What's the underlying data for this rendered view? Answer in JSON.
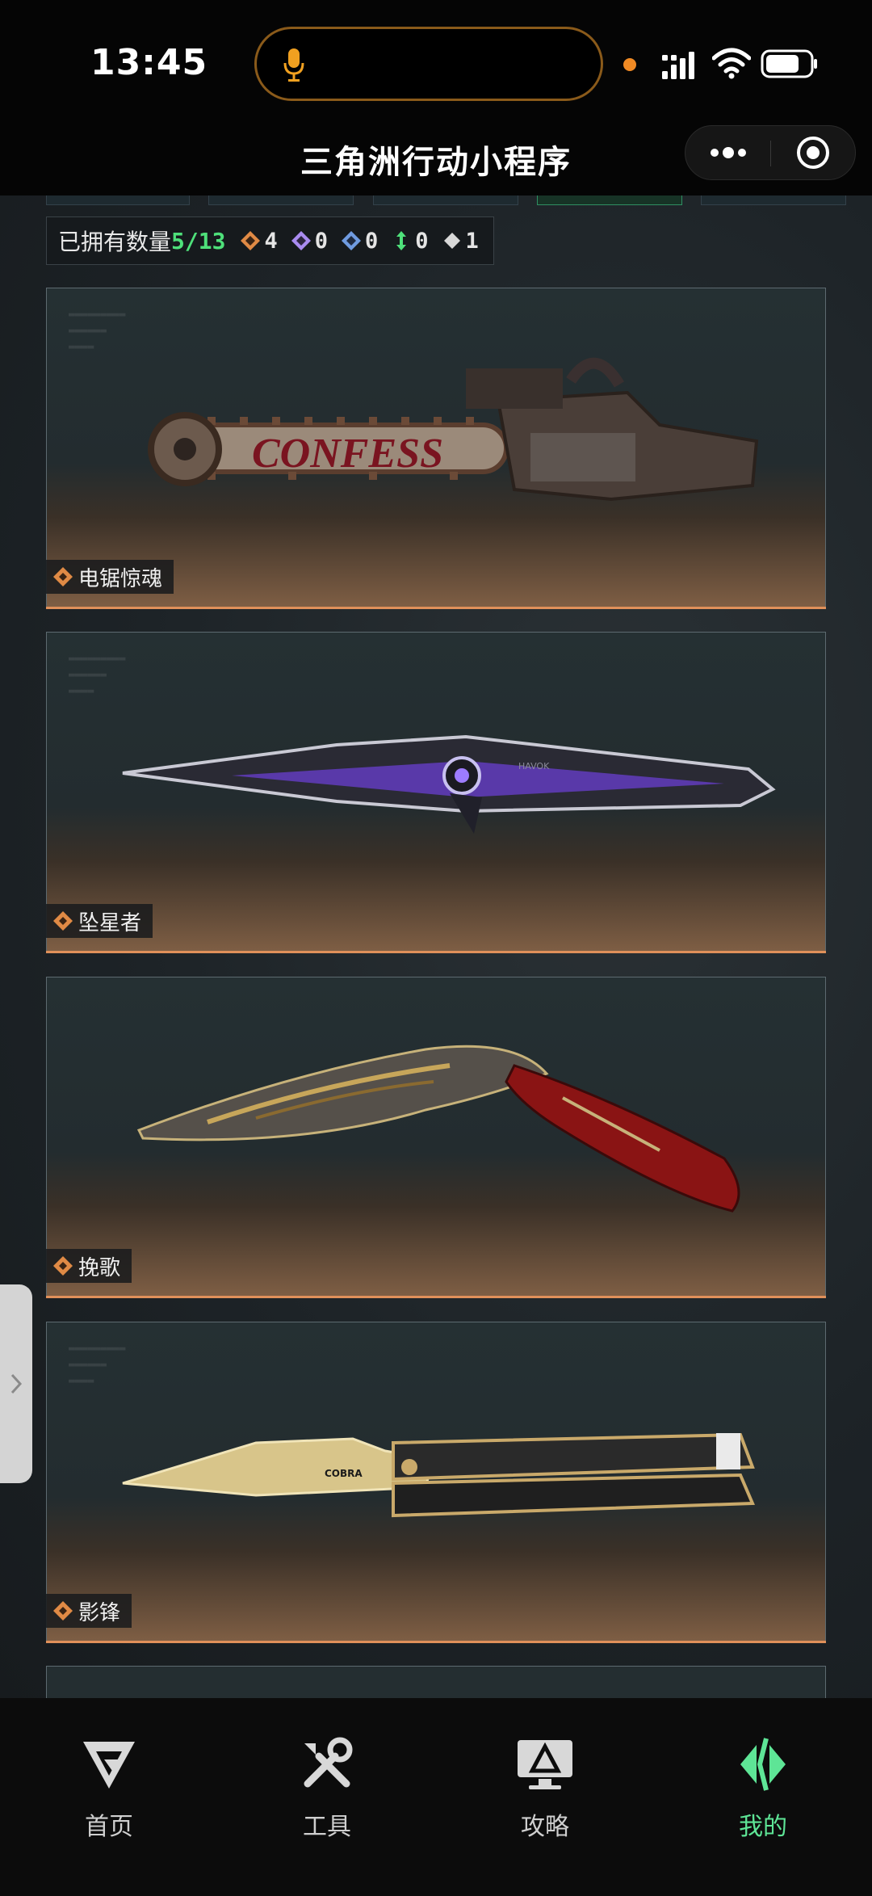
{
  "status_bar": {
    "time": "13:45"
  },
  "nav": {
    "title": "三角洲行动小程序"
  },
  "inventory": {
    "owned_label": "已拥有数量",
    "owned_value": "5/13",
    "rarity_counts": [
      {
        "icon": "gold-diamond-icon",
        "color": "#e08a45",
        "count": "4"
      },
      {
        "icon": "purple-diamond-icon",
        "color": "#a98bf0",
        "count": "0"
      },
      {
        "icon": "blue-diamond-icon",
        "color": "#6f9be0",
        "count": "0"
      },
      {
        "icon": "green-arrow-icon",
        "color": "#4ee07a",
        "count": "0"
      },
      {
        "icon": "white-diamond-icon",
        "color": "#d8d8d8",
        "count": "1"
      }
    ]
  },
  "items": [
    {
      "name": "电锯惊魂",
      "art_text": "CONFESS"
    },
    {
      "name": "坠星者",
      "art_text": "HAVOK"
    },
    {
      "name": "挽歌"
    },
    {
      "name": "影锋",
      "art_text": "COBRA"
    }
  ],
  "tabs": [
    {
      "label": "首页",
      "icon": "home-logo-icon"
    },
    {
      "label": "工具",
      "icon": "tools-icon"
    },
    {
      "label": "攻略",
      "icon": "guide-monitor-icon"
    },
    {
      "label": "我的",
      "icon": "profile-logo-icon",
      "active": true
    }
  ],
  "colors": {
    "accent_green": "#5ee596",
    "gold": "#e08a45",
    "card_border": "#e0905a"
  }
}
